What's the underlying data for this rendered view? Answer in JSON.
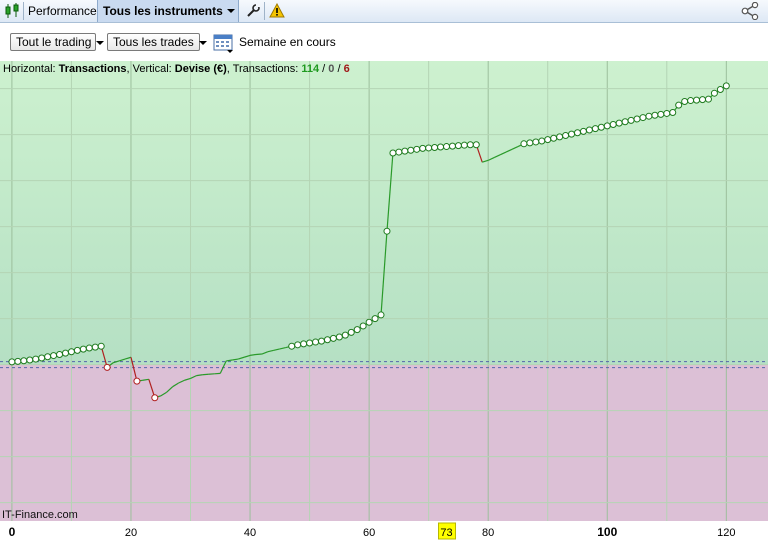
{
  "toolbar": {
    "performance_label": "Performance",
    "instruments_label": "Tous les instruments"
  },
  "filters": {
    "trading_label": "Tout le trading",
    "trades_label": "Tous les trades",
    "period_label": "Semaine en cours"
  },
  "info": {
    "h_label": "Horizontal: ",
    "h_value": "Transactions",
    "v_label": ", Vertical: ",
    "v_value": "Devise (€)",
    "t_label": ", Transactions: ",
    "t_win": "114",
    "slash1": " / ",
    "t_even": "0",
    "slash2": " / ",
    "t_loss": "6"
  },
  "watermark": "IT-Finance.com",
  "colors": {
    "profit_zone": "#bfe6c6",
    "loss_zone": "#dcc0d6",
    "win_line": "#2a9a2a",
    "loss_line": "#b02020",
    "marker_edge": "#1e7a1e",
    "highlight": "#ffff00"
  },
  "icons": {
    "app": "candlestick-icon",
    "tools": "wrench-icon",
    "warning": "warning-icon",
    "share": "share-icon",
    "calendar": "calendar-icon"
  },
  "chart_data": {
    "type": "line",
    "xlabel": "Transactions",
    "ylabel": "Devise (€)",
    "xlim": [
      -2,
      127
    ],
    "ylim": [
      -17,
      33
    ],
    "x_ticks": [
      0,
      20,
      40,
      60,
      80,
      100,
      120
    ],
    "x_bold_ticks": [
      0,
      100
    ],
    "highlight_tick": 73,
    "grid": true,
    "baseline": 0,
    "series": [
      {
        "x": [
          0,
          1,
          2,
          3,
          4,
          5,
          6,
          7,
          8,
          9,
          10,
          11,
          12,
          13,
          14,
          15,
          16,
          17,
          18,
          19,
          20,
          21,
          22,
          23,
          24,
          25,
          26,
          27,
          28,
          29,
          30,
          31,
          32,
          33,
          34,
          35,
          36,
          37,
          38,
          39,
          40,
          41,
          42,
          43,
          44,
          45,
          46,
          47,
          48,
          49,
          50,
          51,
          52,
          53,
          54,
          55,
          56,
          57,
          58,
          59,
          60,
          61,
          62,
          63,
          64,
          65,
          66,
          67,
          68,
          69,
          70,
          71,
          72,
          73,
          74,
          75,
          76,
          77,
          78,
          79,
          80,
          81,
          82,
          83,
          84,
          85,
          86,
          87,
          88,
          89,
          90,
          91,
          92,
          93,
          94,
          95,
          96,
          97,
          98,
          99,
          100,
          101,
          102,
          103,
          104,
          105,
          106,
          107,
          108,
          109,
          110,
          111,
          112,
          113,
          114,
          115,
          116,
          117,
          118,
          119,
          120
        ],
        "y": [
          0.3,
          0.35,
          0.42,
          0.5,
          0.6,
          0.72,
          0.85,
          0.98,
          1.1,
          1.25,
          1.4,
          1.55,
          1.68,
          1.8,
          1.9,
          2.0,
          -0.3,
          0.2,
          0.4,
          0.6,
          0.8,
          -1.8,
          -1.7,
          -1.6,
          -3.6,
          -3.4,
          -3.0,
          -2.4,
          -2.0,
          -1.7,
          -1.5,
          -1.2,
          -1.1,
          -1.05,
          -1.0,
          -0.95,
          0.4,
          0.5,
          0.6,
          0.8,
          1.0,
          1.1,
          1.15,
          1.4,
          1.55,
          1.7,
          1.85,
          2.0,
          2.15,
          2.25,
          2.35,
          2.45,
          2.55,
          2.7,
          2.85,
          3.0,
          3.2,
          3.5,
          3.8,
          4.2,
          4.6,
          5.0,
          5.4,
          14.5,
          23.0,
          23.1,
          23.2,
          23.3,
          23.4,
          23.5,
          23.55,
          23.6,
          23.65,
          23.7,
          23.75,
          23.8,
          23.85,
          23.9,
          23.9,
          22.0,
          22.2,
          22.5,
          22.8,
          23.1,
          23.4,
          23.7,
          24.0,
          24.1,
          24.2,
          24.3,
          24.45,
          24.6,
          24.75,
          24.9,
          25.05,
          25.2,
          25.35,
          25.5,
          25.65,
          25.8,
          25.95,
          26.1,
          26.25,
          26.4,
          26.55,
          26.7,
          26.85,
          27.0,
          27.1,
          27.2,
          27.3,
          27.4,
          28.2,
          28.6,
          28.7,
          28.75,
          28.8,
          28.85,
          29.5,
          29.9,
          30.3
        ]
      }
    ],
    "markers_x": [
      0,
      1,
      2,
      3,
      4,
      5,
      6,
      7,
      8,
      9,
      10,
      11,
      12,
      13,
      14,
      15,
      16,
      21,
      24,
      47,
      48,
      49,
      50,
      51,
      52,
      53,
      54,
      55,
      56,
      57,
      58,
      59,
      60,
      61,
      62,
      63,
      64,
      65,
      66,
      67,
      68,
      69,
      70,
      71,
      72,
      73,
      74,
      75,
      76,
      77,
      78,
      86,
      87,
      88,
      89,
      90,
      91,
      92,
      93,
      94,
      95,
      96,
      97,
      98,
      99,
      100,
      101,
      102,
      103,
      104,
      105,
      106,
      107,
      108,
      109,
      110,
      111,
      112,
      113,
      114,
      115,
      116,
      117,
      118,
      119,
      120
    ],
    "loss_trades_x": [
      16,
      21,
      24,
      79
    ]
  }
}
